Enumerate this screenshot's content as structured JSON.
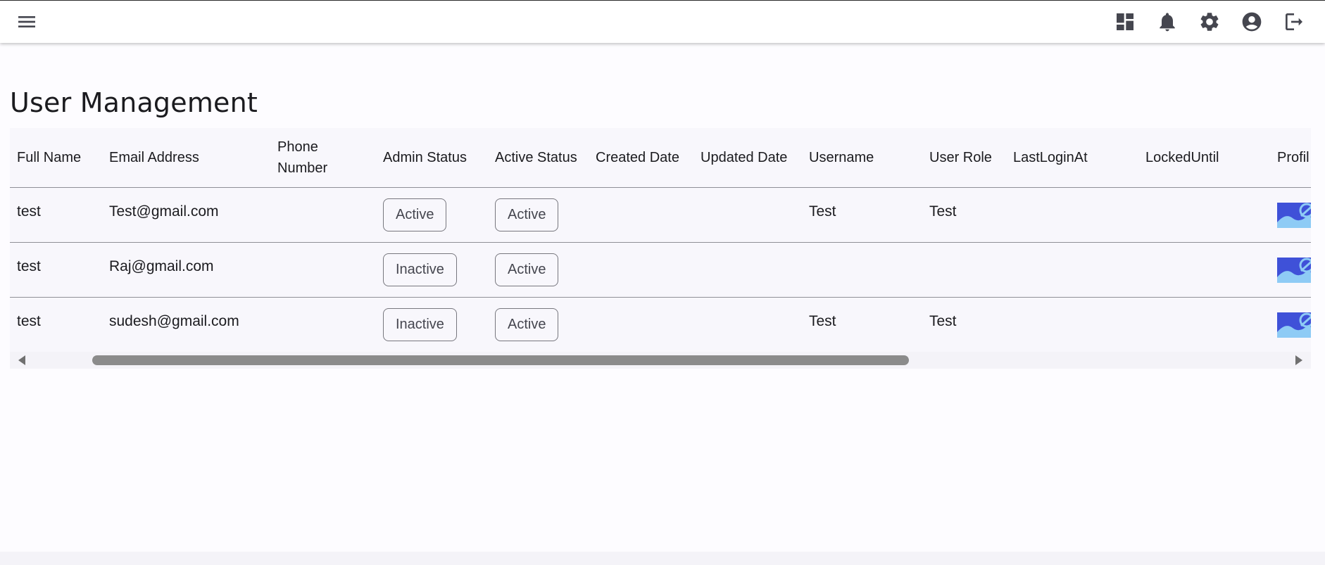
{
  "header": {
    "icons": [
      "menu-icon",
      "dashboard-icon",
      "notifications-icon",
      "settings-icon",
      "account-icon",
      "logout-icon"
    ]
  },
  "page": {
    "title": "User Management"
  },
  "table": {
    "columns": [
      "Full Name",
      "Email Address",
      "Phone Number",
      "Admin Status",
      "Active Status",
      "Created Date",
      "Updated Date",
      "Username",
      "User Role",
      "LastLoginAt",
      "LockedUntil",
      "Profil"
    ],
    "rows": [
      {
        "full_name": "test",
        "email": "Test@gmail.com",
        "phone": "",
        "admin_status": "Active",
        "active_status": "Active",
        "created": "",
        "updated": "",
        "username": "Test",
        "role": "Test",
        "last_login": "",
        "locked_until": "",
        "profile_icon": "image-placeholder-icon"
      },
      {
        "full_name": "test",
        "email": "Raj@gmail.com",
        "phone": "",
        "admin_status": "Inactive",
        "active_status": "Active",
        "created": "",
        "updated": "",
        "username": "",
        "role": "",
        "last_login": "",
        "locked_until": "",
        "profile_icon": "image-placeholder-icon"
      },
      {
        "full_name": "test",
        "email": "sudesh@gmail.com",
        "phone": "",
        "admin_status": "Inactive",
        "active_status": "Active",
        "created": "",
        "updated": "",
        "username": "Test",
        "role": "Test",
        "last_login": "",
        "locked_until": "",
        "profile_icon": "image-placeholder-icon"
      }
    ]
  },
  "colors": {
    "icon": "#45464f",
    "surface": "#f8f7fc",
    "divider": "#8f8f96",
    "thumb_blue": "#3f51d8",
    "thumb_light": "#8ecbf5"
  }
}
